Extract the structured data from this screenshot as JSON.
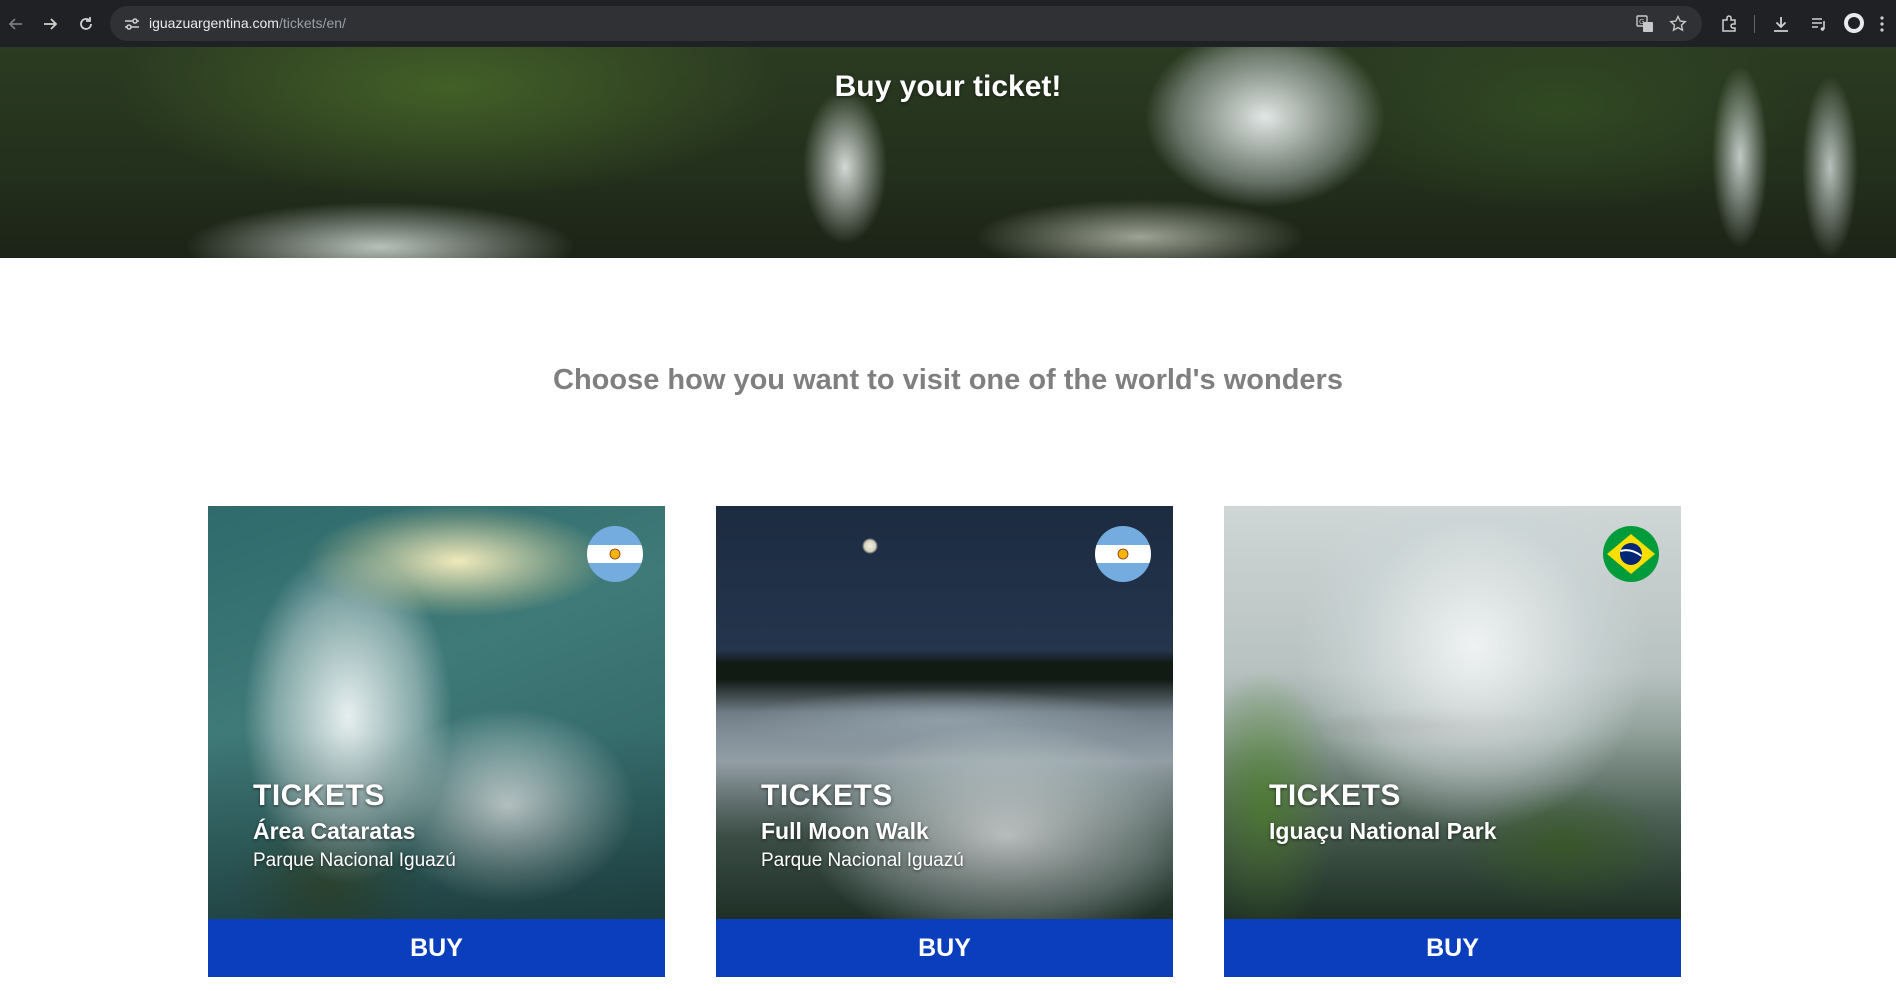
{
  "browser": {
    "url_domain": "iguazuargentina.com",
    "url_path": "/tickets/en/",
    "icons": {
      "back": "arrow-left-icon",
      "forward": "arrow-right-icon",
      "reload": "reload-icon",
      "site_info": "tune-icon",
      "translate": "translate-icon",
      "bookmark": "star-icon",
      "extensions": "puzzle-icon",
      "downloads": "download-icon",
      "media": "playlist-icon",
      "profile": "profile-icon",
      "menu": "kebab-menu-icon"
    }
  },
  "hero": {
    "title": "Buy your ticket!"
  },
  "subtitle": "Choose how you want to visit one of the world's wonders",
  "cards": [
    {
      "kicker": "TICKETS",
      "name": "Área Cataratas",
      "park": "Parque Nacional Iguazú",
      "flag": "argentina-flag-icon",
      "button": "BUY"
    },
    {
      "kicker": "TICKETS",
      "name": "Full Moon Walk",
      "park": "Parque Nacional Iguazú",
      "flag": "argentina-flag-icon",
      "button": "BUY"
    },
    {
      "kicker": "TICKETS",
      "name": "Iguaçu National Park",
      "park": "",
      "flag": "brazil-flag-icon",
      "button": "BUY"
    }
  ],
  "colors": {
    "buy_button": "#0b3ebd",
    "subtitle": "#7f7f7f",
    "chrome": "#202124",
    "argentina_blue": "#74acdf",
    "brazil_green": "#009b3a",
    "brazil_yellow": "#fedf00",
    "brazil_blue": "#002776"
  }
}
